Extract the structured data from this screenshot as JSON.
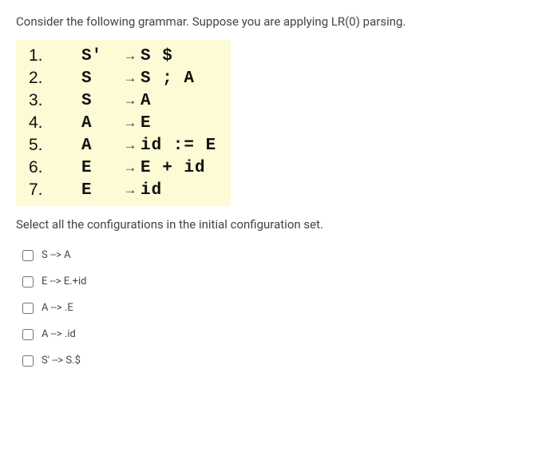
{
  "prompt": "Consider the following grammar. Suppose you are applying LR(0) parsing.",
  "grammar": [
    {
      "num": "1.",
      "lhs": "S'",
      "arrow": "→",
      "rhs": "S $"
    },
    {
      "num": "2.",
      "lhs": "S",
      "arrow": "→",
      "rhs": "S ; A"
    },
    {
      "num": "3.",
      "lhs": "S",
      "arrow": "→",
      "rhs": "A"
    },
    {
      "num": "4.",
      "lhs": "A",
      "arrow": "→",
      "rhs": "E"
    },
    {
      "num": "5.",
      "lhs": "A",
      "arrow": "→",
      "rhs": "id  := E"
    },
    {
      "num": "6.",
      "lhs": "E",
      "arrow": "→",
      "rhs": "E + id"
    },
    {
      "num": "7.",
      "lhs": "E",
      "arrow": "→",
      "rhs": "id"
    }
  ],
  "subprompt": "Select all the configurations in the initial configuration set.",
  "options": [
    {
      "label": "S --> A"
    },
    {
      "label": "E --> E.+id"
    },
    {
      "label": "A --> .E"
    },
    {
      "label": "A --> .id"
    },
    {
      "label": "S' --> S.$"
    }
  ]
}
